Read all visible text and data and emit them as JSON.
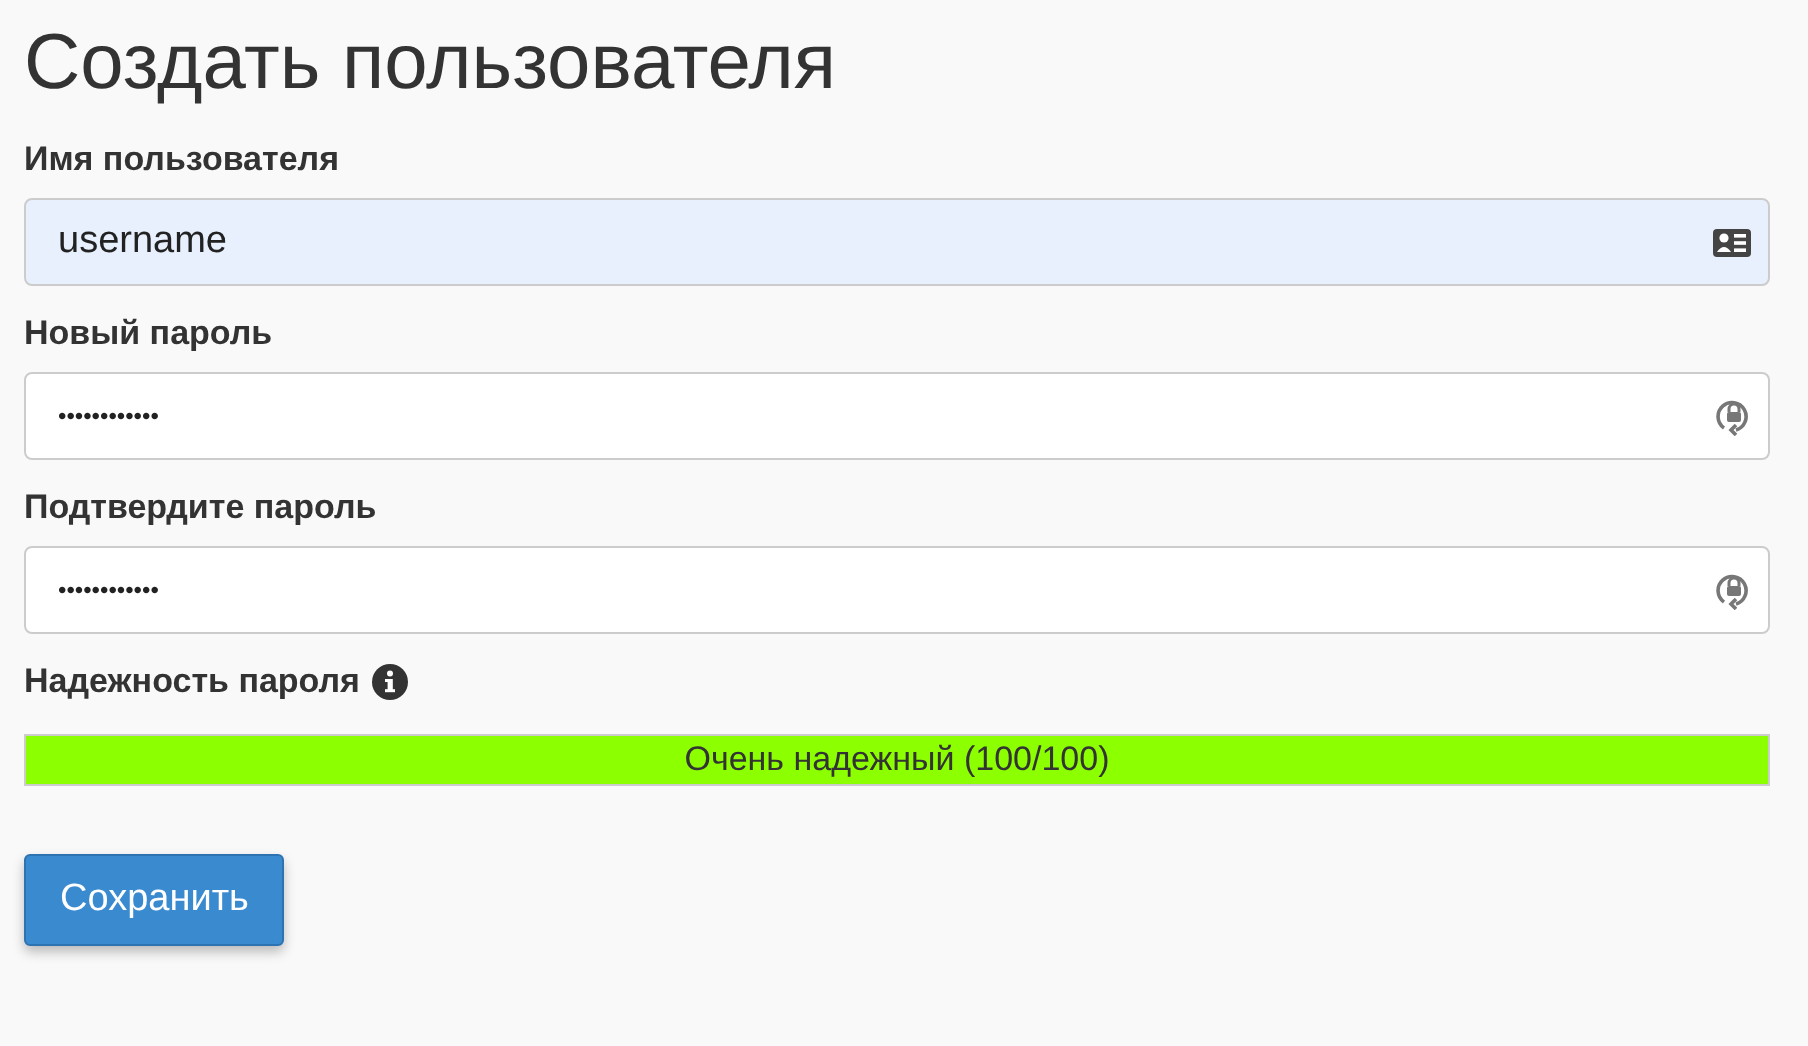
{
  "title": "Создать пользователя",
  "fields": [
    {
      "label": "Имя пользователя",
      "value": "username",
      "kind": "username",
      "autofilled": true
    },
    {
      "label": "Новый пароль",
      "value": "••••••••••••",
      "kind": "password",
      "autofilled": false
    },
    {
      "label": "Подтвердите пароль",
      "value": "••••••••••••",
      "kind": "password",
      "autofilled": false
    }
  ],
  "strength": {
    "label": "Надежность пароля",
    "level": 1,
    "reading": "Очень надежный (100/100)"
  },
  "save_button": "Сохранить"
}
